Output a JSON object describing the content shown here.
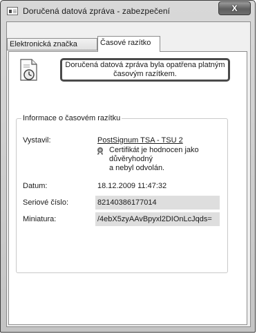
{
  "window": {
    "title": "Doručená datová zpráva - zabezpečení",
    "close_label": "X"
  },
  "tabs": [
    {
      "label": "Elektronická značka",
      "active": false
    },
    {
      "label": "Časové razítko",
      "active": true
    }
  ],
  "banner": {
    "line1": "Doručená datová zpráva byla opatřena platným",
    "line2": "časovým razítkem."
  },
  "group": {
    "legend": "Informace o časovém razítku"
  },
  "fields": {
    "issuer_label": "Vystavil:",
    "issuer_value": "PostSignum TSA - TSU 2",
    "cert_status_line1": "Certifikát je hodnocen jako důvěryhodný",
    "cert_status_line2": "a nebyl odvolán.",
    "date_label": "Datum:",
    "date_value": "18.12.2009 11:47:32",
    "serial_label": "Seriové číslo:",
    "serial_value": "82140386177014",
    "thumbnail_label": "Miniatura:",
    "thumbnail_value": "/4ebX5zyAAvBpyxl2DIOnLcJqds="
  },
  "icons": {
    "window_icon": "window-icon",
    "document_icon": "document-clock-icon",
    "cert_icon": "certificate-icon"
  }
}
